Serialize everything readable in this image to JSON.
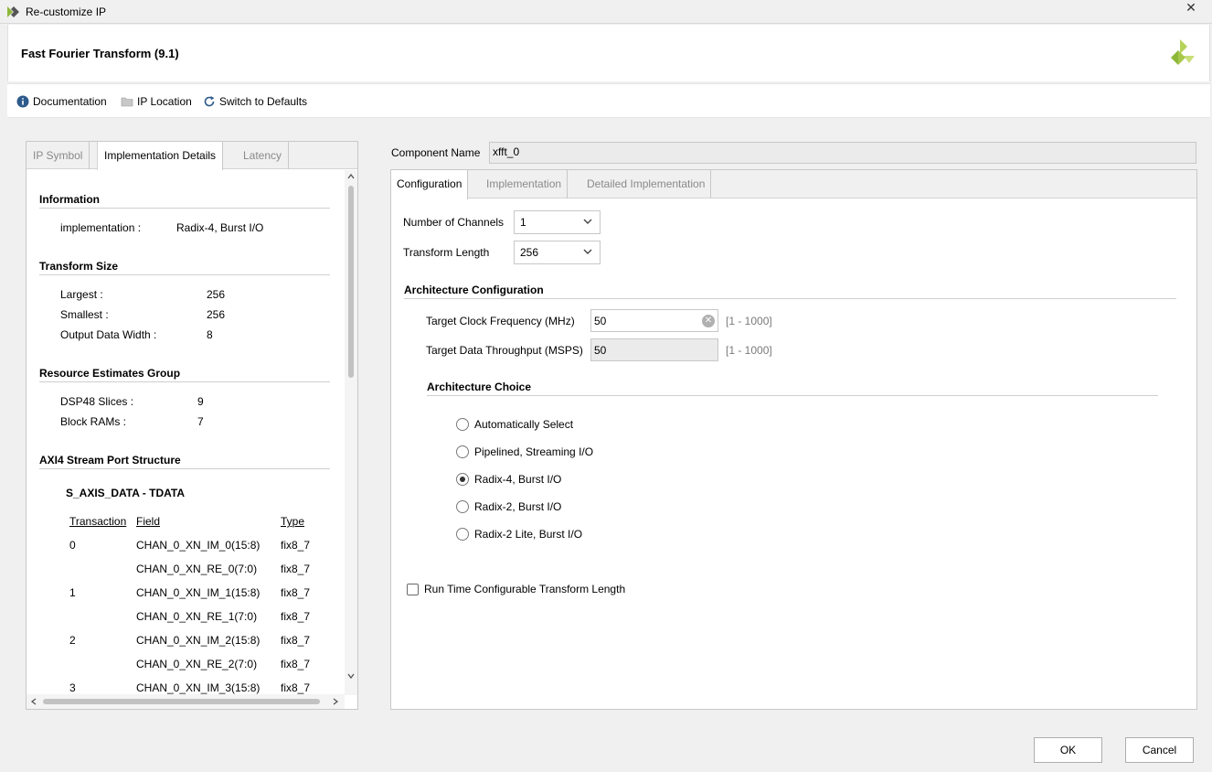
{
  "window": {
    "title": "Re-customize IP",
    "close_glyph": "✕"
  },
  "header": {
    "title": "Fast Fourier Transform (9.1)"
  },
  "toolbar": {
    "documentation": "Documentation",
    "ip_location": "IP Location",
    "switch_defaults": "Switch to Defaults"
  },
  "left": {
    "tabs": [
      "IP Symbol",
      "Implementation Details",
      "Latency"
    ],
    "info": {
      "heading": "Information",
      "key": "implementation :",
      "value": "Radix-4, Burst I/O"
    },
    "transform": {
      "heading": "Transform Size",
      "rows": [
        {
          "key": "Largest :",
          "value": "256"
        },
        {
          "key": "Smallest :",
          "value": "256"
        },
        {
          "key": "Output Data Width :",
          "value": "8"
        }
      ]
    },
    "resource": {
      "heading": "Resource Estimates Group",
      "rows": [
        {
          "key": "DSP48 Slices :",
          "value": "9"
        },
        {
          "key": "Block RAMs :",
          "value": "7"
        }
      ]
    },
    "axi": {
      "heading": "AXI4 Stream Port Structure",
      "sub": "S_AXIS_DATA - TDATA",
      "headers": {
        "transaction": "Transaction",
        "field": "Field",
        "type": "Type"
      },
      "rows": [
        {
          "t": "0",
          "f": "CHAN_0_XN_IM_0(15:8)",
          "ty": "fix8_7"
        },
        {
          "t": "",
          "f": "CHAN_0_XN_RE_0(7:0)",
          "ty": "fix8_7"
        },
        {
          "t": "1",
          "f": "CHAN_0_XN_IM_1(15:8)",
          "ty": "fix8_7"
        },
        {
          "t": "",
          "f": "CHAN_0_XN_RE_1(7:0)",
          "ty": "fix8_7"
        },
        {
          "t": "2",
          "f": "CHAN_0_XN_IM_2(15:8)",
          "ty": "fix8_7"
        },
        {
          "t": "",
          "f": "CHAN_0_XN_RE_2(7:0)",
          "ty": "fix8_7"
        },
        {
          "t": "3",
          "f": "CHAN_0_XN_IM_3(15:8)",
          "ty": "fix8_7"
        }
      ]
    }
  },
  "component": {
    "label": "Component Name",
    "value": "xfft_0"
  },
  "right": {
    "tabs": [
      "Configuration",
      "Implementation",
      "Detailed Implementation"
    ],
    "channels": {
      "label": "Number of Channels",
      "value": "1"
    },
    "length": {
      "label": "Transform Length",
      "value": "256"
    },
    "arch": {
      "heading": "Architecture Configuration",
      "clock": {
        "label": "Target Clock Frequency (MHz)",
        "value": "50",
        "range": "[1 - 1000]"
      },
      "throughput": {
        "label": "Target Data Throughput (MSPS)",
        "value": "50",
        "range": "[1 - 1000]"
      },
      "choice_heading": "Architecture Choice",
      "options": [
        "Automatically Select",
        "Pipelined, Streaming I/O",
        "Radix-4, Burst I/O",
        "Radix-2, Burst I/O",
        "Radix-2 Lite, Burst I/O"
      ],
      "selected": "Radix-4, Burst I/O"
    },
    "runtime": {
      "label": "Run Time Configurable Transform Length",
      "checked": false
    }
  },
  "buttons": {
    "ok": "OK",
    "cancel": "Cancel"
  },
  "colors": {
    "accent_logo": "#8db73a",
    "tab_inactive": "#8a8a8a",
    "range_text": "#7a7a7a"
  }
}
